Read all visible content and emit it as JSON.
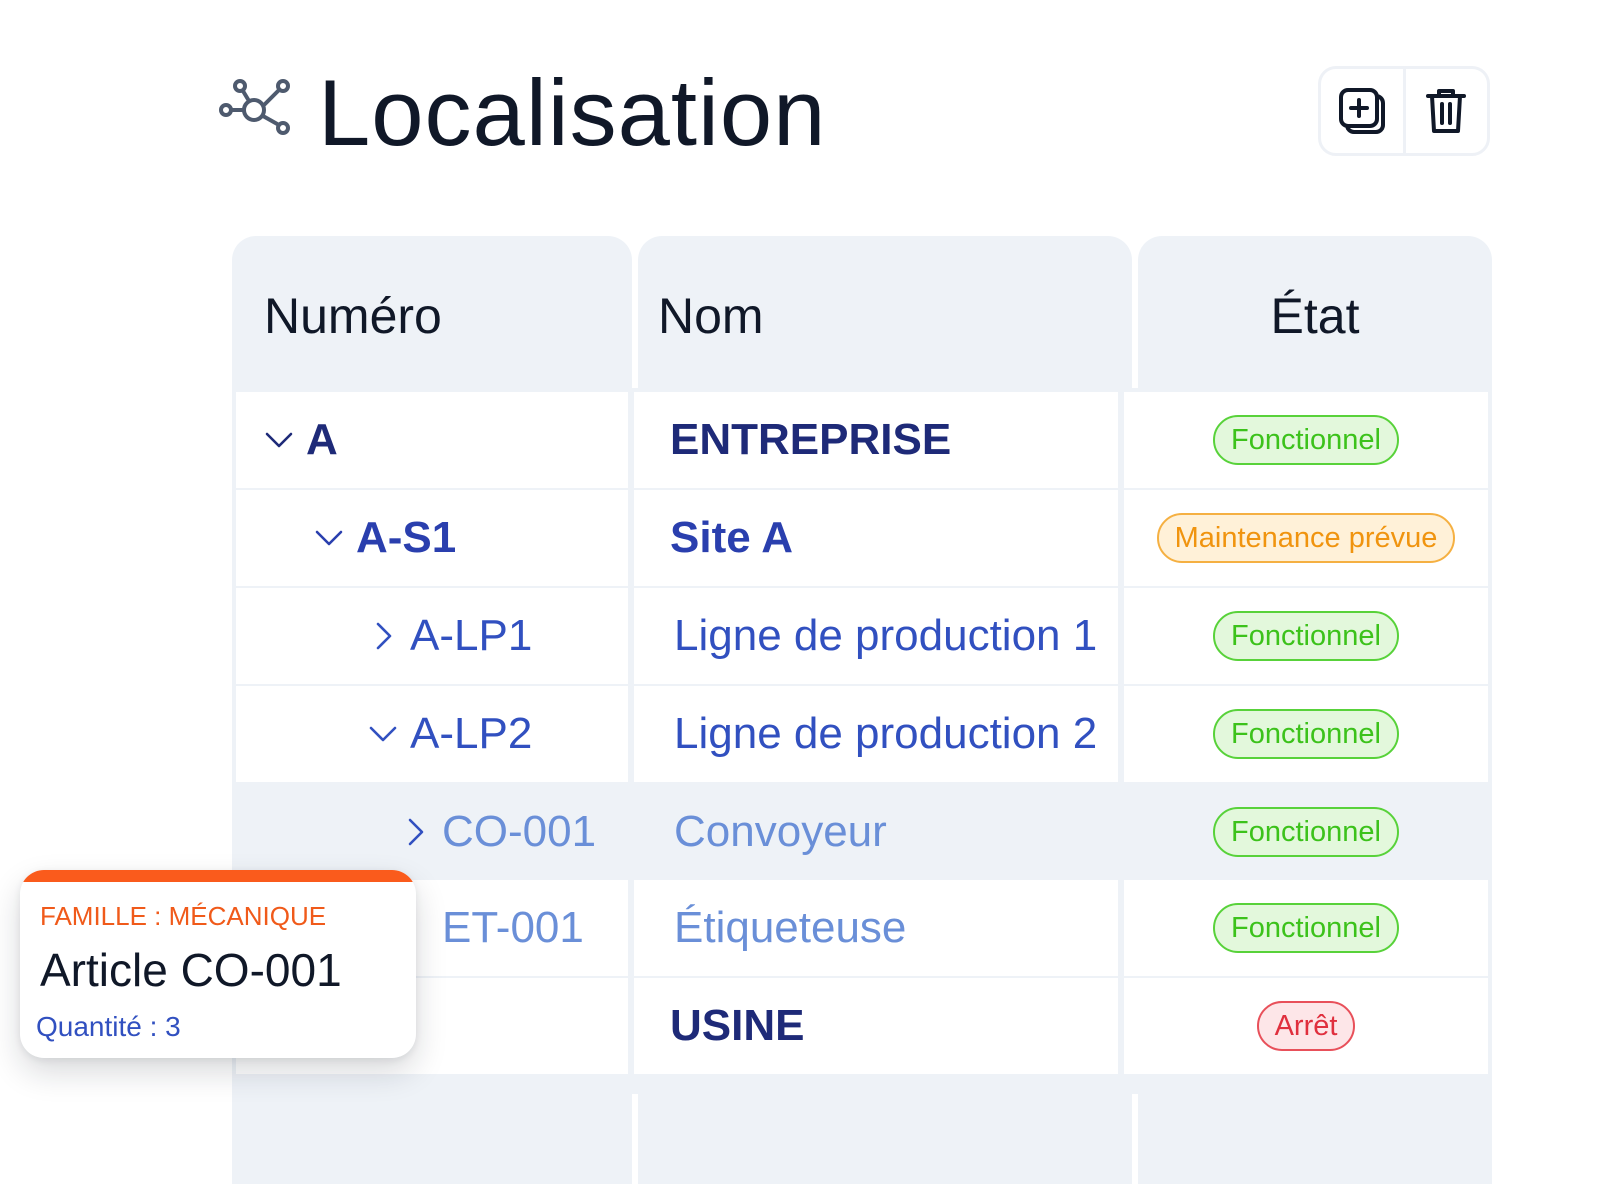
{
  "header": {
    "icon": "network-icon",
    "title": "Localisation",
    "actions": [
      {
        "name": "add-button",
        "icon": "plus-square-icon"
      },
      {
        "name": "delete-button",
        "icon": "trash-icon"
      }
    ]
  },
  "table": {
    "columns": [
      "Numéro",
      "Nom",
      "État"
    ],
    "rows": [
      {
        "number": "A",
        "name": "ENTREPRISE",
        "status": "Fonctionnel",
        "status_type": "ok",
        "level": 0,
        "chevron": "down"
      },
      {
        "number": "A-S1",
        "name": "Site A",
        "status": "Maintenance prévue",
        "status_type": "warn",
        "level": 1,
        "chevron": "down"
      },
      {
        "number": "A-LP1",
        "name": "Ligne de production 1",
        "status": "Fonctionnel",
        "status_type": "ok",
        "level": 2,
        "chevron": "right"
      },
      {
        "number": "A-LP2",
        "name": "Ligne de production 2",
        "status": "Fonctionnel",
        "status_type": "ok",
        "level": 2,
        "chevron": "down"
      },
      {
        "number": "CO-001",
        "name": "Convoyeur",
        "status": "Fonctionnel",
        "status_type": "ok",
        "level": 3,
        "chevron": "right",
        "highlighted": true
      },
      {
        "number": "ET-001",
        "name": "Étiqueteuse",
        "status": "Fonctionnel",
        "status_type": "ok",
        "level": 3,
        "chevron": "none"
      },
      {
        "number": "",
        "name": "USINE",
        "status": "Arrêt",
        "status_type": "stop",
        "level": 0,
        "chevron": "none"
      }
    ]
  },
  "popup": {
    "family": "FAMILLE : MÉCANIQUE",
    "title": "Article CO-001",
    "quantity": "Quantité : 3"
  },
  "colors": {
    "ok_text": "#3cc21b",
    "ok_bg": "#e3f8dc",
    "ok_border": "#58d23a",
    "warn_text": "#f0940f",
    "warn_bg": "#fff1d8",
    "warn_border": "#f5b042",
    "stop_text": "#e0303e",
    "stop_bg": "#fde6e8",
    "stop_border": "#e8505a",
    "accent": "#fa5b1c"
  }
}
